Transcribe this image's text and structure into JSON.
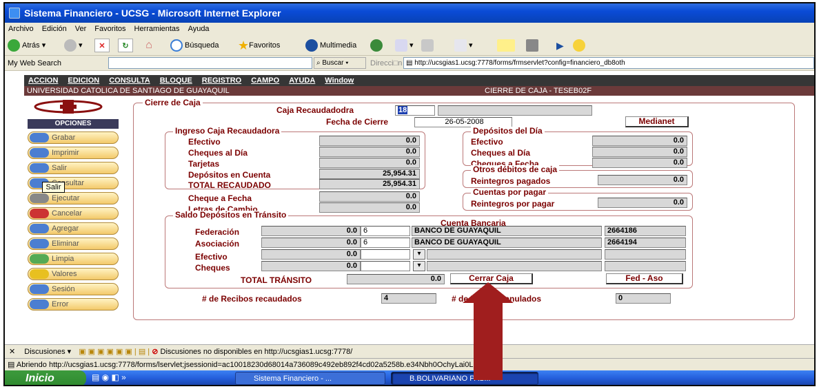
{
  "window": {
    "title": "Sistema Financiero - UCSG - Microsoft Internet Explorer"
  },
  "menu": [
    "Archivo",
    "Edición",
    "Ver",
    "Favoritos",
    "Herramientas",
    "Ayuda"
  ],
  "toolbar": {
    "back": "Atrás",
    "search": "Búsqueda",
    "favorites": "Favoritos",
    "multimedia": "Multimedia"
  },
  "addressbar": {
    "websearch": "My Web Search",
    "buscar": "Buscar",
    "direccion": "Direcci□n",
    "url": "http://ucsgias1.ucsg:7778/forms/frmservlet?config=financiero_db8oth"
  },
  "appmenu": [
    "ACCION",
    "EDICION",
    "CONSULTA",
    "BLOQUE",
    "REGISTRO",
    "CAMPO",
    "AYUDA",
    "Window"
  ],
  "header": {
    "university": "UNIVERSIDAD CATOLICA DE SANTIAGO DE GUAYAQUIL",
    "screen": "CIERRE DE CAJA - TESEB02F"
  },
  "sidebar": {
    "title": "OPCIONES",
    "items": [
      "Grabar",
      "Imprimir",
      "Salir",
      "Consultar",
      "Ejecutar",
      "Cancelar",
      "Agregar",
      "Eliminar",
      "Limpia",
      "Valores",
      "Sesión",
      "Error"
    ],
    "tooltip": "Salir"
  },
  "form": {
    "group_title": "Cierre de Caja",
    "caja_label": "Caja Recaudadodra",
    "caja_value": "18",
    "fecha_label": "Fecha de Cierre",
    "fecha_value": "26-05-2008",
    "medianet": "Medianet",
    "ingreso": {
      "title": "Ingreso Caja Recaudadora",
      "efectivo_l": "Efectivo",
      "efectivo": "0.0",
      "cheques_l": "Cheques al Día",
      "cheques": "0.0",
      "tarjetas_l": "Tarjetas",
      "tarjetas": "0.0",
      "depositos_l": "Depósitos en Cuenta",
      "depositos": "25,954.31",
      "total_l": "TOTAL RECAUDADO",
      "total": "25,954.31"
    },
    "cheque_fecha_l": "Cheque a Fecha",
    "cheque_fecha": "0.0",
    "letras_l": "Letras de Cambio",
    "letras": "0.0",
    "depdia": {
      "title": "Depósitos del Día",
      "efectivo_l": "Efectivo",
      "efectivo": "0.0",
      "cheques_l": "Cheques al Día",
      "cheques": "0.0",
      "chfecha_l": "Cheques a Fecha",
      "chfecha": "0.0"
    },
    "otros": {
      "title": "Otros débitos de caja",
      "reint_l": "Reintegros pagados",
      "reint": "0.0"
    },
    "cxp": {
      "title": "Cuentas por pagar",
      "reint_l": "Reintegros por pagar",
      "reint": "0.0"
    },
    "transito": {
      "title": "Saldo Depósitos en Tránsito",
      "cuenta_l": "Cuenta Bancaria",
      "fed_l": "Federación",
      "fed": "0.0",
      "fed_code": "6",
      "fed_bank": "BANCO DE GUAYAQUIL",
      "fed_acct": "2664186",
      "aso_l": "Asociación",
      "aso": "0.0",
      "aso_code": "6",
      "aso_bank": "BANCO DE GUAYAQUIL",
      "aso_acct": "2664194",
      "ef_l": "Efectivo",
      "ef": "0.0",
      "ch_l": "Cheques",
      "ch": "0.0",
      "total_l": "TOTAL TRÁNSITO",
      "total": "0.0"
    },
    "cerrar": "Cerrar Caja",
    "fedaso": "Fed - Aso",
    "recibos_l": "# de Recibos recaudados",
    "recibos": "4",
    "anulados_l": "# de Recibos anulados",
    "anulados": "0"
  },
  "discbar": {
    "label": "Discusiones",
    "msg": "Discusiones no disponibles en http://ucsgias1.ucsg:7778/"
  },
  "status": "Abriendo http://ucsgias1.ucsg:7778/forms/lservlet;jsessionid=ac10018230d68014a736089c492eb892f4cd02a5258b.e34Nbh0OchyLai0Lah8Mb",
  "taskbar": {
    "start": "Inicio",
    "task1": "Sistema Financiero - ...",
    "task2": "B.BOLIVARIANO PAS..."
  }
}
